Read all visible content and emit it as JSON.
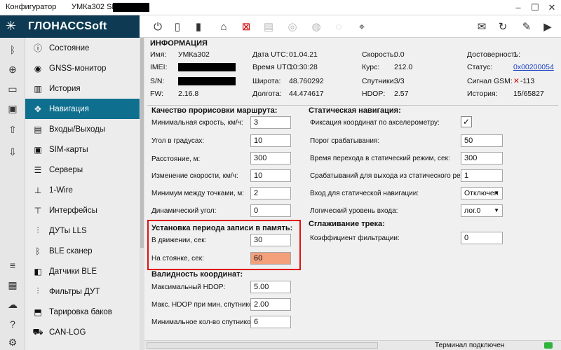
{
  "titlebar": {
    "app_name": "Конфигуратор",
    "device": "УМКа302 SN:"
  },
  "brand": {
    "name": "ГЛОНАССSoft"
  },
  "nav": [
    {
      "label": "Состояние",
      "icon": "info-icon"
    },
    {
      "label": "GNSS-монитор",
      "icon": "satellite-icon"
    },
    {
      "label": "История",
      "icon": "book-icon"
    },
    {
      "label": "Навигация",
      "icon": "navigation-icon"
    },
    {
      "label": "Входы/Выходы",
      "icon": "io-icon"
    },
    {
      "label": "SIM-карты",
      "icon": "sim-icon"
    },
    {
      "label": "Серверы",
      "icon": "server-icon"
    },
    {
      "label": "1-Wire",
      "icon": "onewire-icon"
    },
    {
      "label": "Интерфейсы",
      "icon": "interface-icon"
    },
    {
      "label": "ДУТы LLS",
      "icon": "fuel-sensor-icon"
    },
    {
      "label": "BLE сканер",
      "icon": "bluetooth-icon"
    },
    {
      "label": "Датчики BLE",
      "icon": "ble-sensor-icon"
    },
    {
      "label": "Фильтры ДУТ",
      "icon": "filter-icon"
    },
    {
      "label": "Тарировка баков",
      "icon": "tank-icon"
    },
    {
      "label": "CAN-LOG",
      "icon": "can-icon"
    }
  ],
  "info": {
    "title": "ИНФОРМАЦИЯ",
    "name_label": "Имя:",
    "name_value": "УМКа302",
    "imei_label": "IMEI:",
    "sn_label": "S/N:",
    "fw_label": "FW:",
    "fw_value": "2.16.8",
    "date_label": "Дата UTC:",
    "date_value": "01.04.21",
    "time_label": "Время UTC:",
    "time_value": "10:30:28",
    "lat_label": "Широта:",
    "lat_value": "48.760292",
    "lon_label": "Долгота:",
    "lon_value": "44.474617",
    "speed_label": "Скорость:",
    "speed_value": "0.0",
    "course_label": "Курс:",
    "course_value": "212.0",
    "sats_label": "Спутники:",
    "sats_value": "3/3",
    "hdop_label": "HDOP:",
    "hdop_value": "2.57",
    "valid_label": "Достоверность:",
    "valid_value": "1",
    "status_label": "Статус:",
    "status_value": "0x00200054",
    "gsm_label": "Сигнал GSM:",
    "gsm_value": "-113",
    "history_label": "История:",
    "history_value": "15/65827"
  },
  "route_quality": {
    "title": "Качество прорисовки маршрута:",
    "fields": [
      {
        "label": "Минимальная скрость, км/ч:",
        "value": "3"
      },
      {
        "label": "Угол в градусах:",
        "value": "10"
      },
      {
        "label": "Расстояние, м:",
        "value": "300"
      },
      {
        "label": "Изменение скорости, км/ч:",
        "value": "10"
      },
      {
        "label": "Минимум между точками, м:",
        "value": "2"
      },
      {
        "label": "Динамический угол:",
        "value": "0"
      }
    ]
  },
  "record_period": {
    "title": "Установка периода записи в память:",
    "fields": [
      {
        "label": "В движении, сек:",
        "value": "30"
      },
      {
        "label": "На стоянке, сек:",
        "value": "60"
      }
    ]
  },
  "coord_validity": {
    "title": "Валидность координат:",
    "fields": [
      {
        "label": "Максимальный HDOP:",
        "value": "5.00"
      },
      {
        "label": "Макс. HDOP при мин. спутников:",
        "value": "2.00"
      },
      {
        "label": "Минимальное кол-во спутников:",
        "value": "6"
      }
    ]
  },
  "static_nav": {
    "title": "Статическая навигация:",
    "accel_label": "Фиксация координат по акселерометру:",
    "accel_checked": "✓",
    "fields": [
      {
        "label": "Порог срабатывания:",
        "value": "50"
      },
      {
        "label": "Время перехода в статический режим, сек:",
        "value": "300"
      },
      {
        "label": "Срабатываний для выхода из статического режима:",
        "value": "1"
      }
    ],
    "input_label": "Вход для статической навигации:",
    "input_value": "Отключен",
    "level_label": "Логический уровень входа:",
    "level_value": "лог.0"
  },
  "smoothing": {
    "title": "Сглаживание трека:",
    "coef_label": "Коэффициент фильтрации:",
    "coef_value": "0"
  },
  "status": {
    "text": "Терминал подключен"
  },
  "colors": {
    "brand_bg": "#0e3b53",
    "active_nav": "#0e6f8f",
    "highlight_input": "#f3a07a",
    "highlight_border": "#e01010",
    "status_ok": "#2fb33a"
  }
}
